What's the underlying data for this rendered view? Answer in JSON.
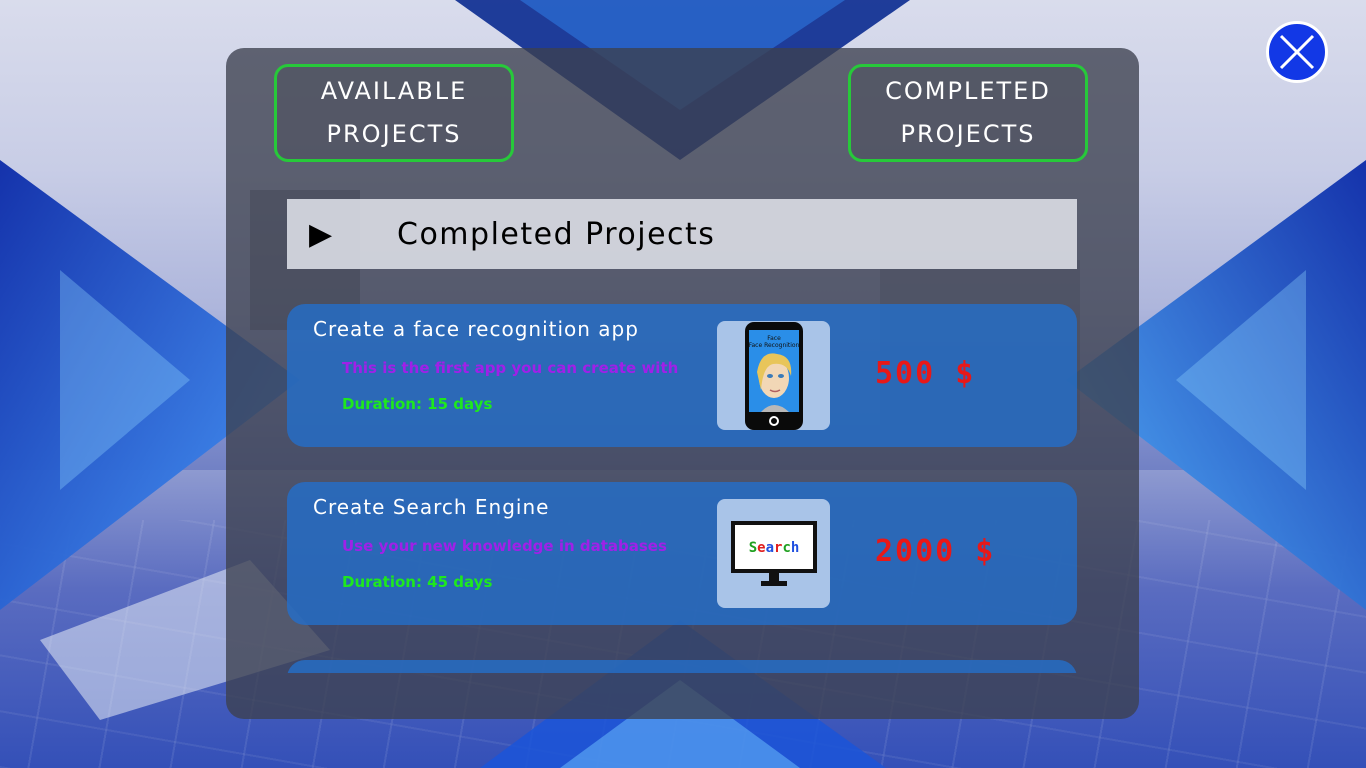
{
  "tabs": {
    "available": {
      "line1": "AVAILABLE",
      "line2": "PROJECTS"
    },
    "completed": {
      "line1": "COMPLETED",
      "line2": "PROJECTS"
    }
  },
  "section": {
    "arrow": "▶",
    "title": "Completed Projects"
  },
  "projects": [
    {
      "title": "Create a face recognition app",
      "description": "This is the first app you can create with",
      "duration": "Duration: 15 days",
      "price": "500 $",
      "thumb_icon": "phone-face-icon",
      "thumb_text": "Face Recognition"
    },
    {
      "title": "Create Search Engine",
      "description": "Use your new knowledge in databases",
      "duration": "Duration: 45 days",
      "price": "2000 $",
      "thumb_icon": "monitor-search-icon",
      "thumb_text": "Search"
    }
  ],
  "colors": {
    "tab_border": "#27c93a",
    "card_bg": "#256ec8",
    "description": "#a020e8",
    "duration": "#1ee81e",
    "price": "#e81818",
    "close_bg": "#1238e6"
  },
  "close_icon": "close-icon"
}
